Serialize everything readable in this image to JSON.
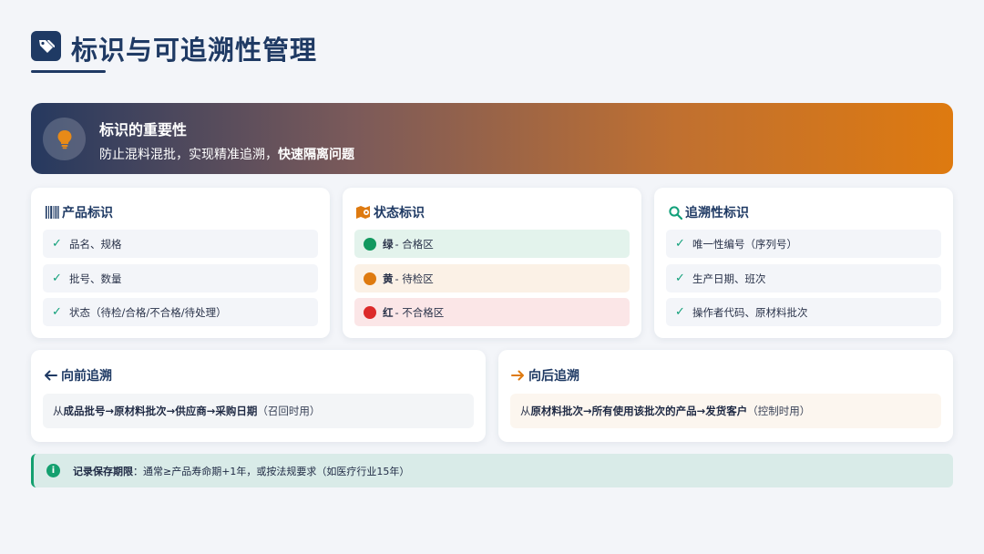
{
  "title": "标识与可追溯性管理",
  "banner": {
    "title": "标识的重要性",
    "subtitle_plain": "防止混料混批，实现精准追溯，",
    "subtitle_bold": "快速隔离问题"
  },
  "cards": {
    "product": {
      "title": "产品标识",
      "items": [
        "品名、规格",
        "批号、数量",
        "状态（待检/合格/不合格/待处理）"
      ]
    },
    "status": {
      "title": "状态标识",
      "items": [
        {
          "color_name": "绿",
          "text": " - 合格区",
          "dot": "#12985f",
          "bg": "#e3f3ec"
        },
        {
          "color_name": "黄",
          "text": " - 待检区",
          "dot": "#de7a10",
          "bg": "#fbf1e6"
        },
        {
          "color_name": "红",
          "text": " - 不合格区",
          "dot": "#dc2a2a",
          "bg": "#fbe6e7"
        }
      ]
    },
    "traceability": {
      "title": "追溯性标识",
      "items": [
        "唯一性编号（序列号）",
        "生产日期、班次",
        "操作者代码、原材料批次"
      ]
    }
  },
  "forward": {
    "title": "向前追溯",
    "prefix": "从",
    "chain": "成品批号→原材料批次→供应商→采购日期",
    "note": "（召回时用）"
  },
  "backward": {
    "title": "向后追溯",
    "prefix": "从",
    "chain": "原材料批次→所有使用该批次的产品→发货客户",
    "note": "（控制时用）"
  },
  "footer": {
    "label": "记录保存期限",
    "text": "：通常≥产品寿命期+1年，或按法规要求（如医疗行业15年）"
  },
  "colors": {
    "navy": "#1f3a64",
    "orange": "#de7a10",
    "green": "#12a07a"
  }
}
